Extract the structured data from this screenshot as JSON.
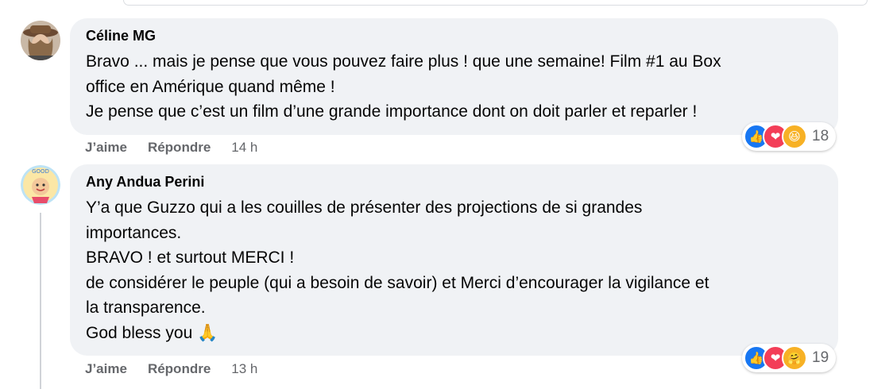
{
  "comments": [
    {
      "author": "Céline MG",
      "text": "Bravo ... mais je pense que vous pouvez faire plus ! que une semaine! Film #1 au Box\noffice en Amérique quand même !\nJe pense que c’est un film d’une grande importance dont on doit parler et reparler !",
      "like_label": "J’aime",
      "reply_label": "Répondre",
      "time": "14 h",
      "reaction_count": "18",
      "reactions": [
        "like-icon",
        "love-icon",
        "haha-icon"
      ]
    },
    {
      "author": "Any Andua Perini",
      "text": "Y’a que Guzzo qui a les couilles de présenter des projections de si grandes\nimportances.\nBRAVO ! et surtout MERCI !\nde considérer le peuple (qui a besoin de savoir) et Merci d’encourager la vigilance et\nla transparence.\nGod bless you 🙏",
      "like_label": "J’aime",
      "reply_label": "Répondre",
      "time": "13 h",
      "reaction_count": "19",
      "reactions": [
        "like-icon",
        "love-icon",
        "care-icon"
      ]
    }
  ]
}
